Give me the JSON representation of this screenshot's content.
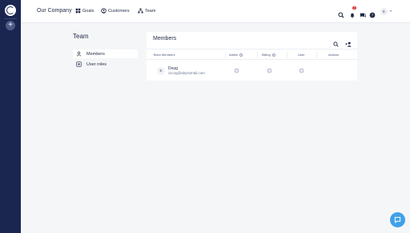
{
  "rail": {
    "logo": "app-logo-icon",
    "add_label": "+"
  },
  "topbar": {
    "company": "Our Company",
    "nav": [
      {
        "label": "Goals",
        "icon": "goals-icon"
      },
      {
        "label": "Customers",
        "icon": "customers-icon"
      },
      {
        "label": "Team",
        "icon": "team-icon"
      }
    ],
    "notifications_count": "1",
    "avatar_initial": "E"
  },
  "sidebar": {
    "title": "Team",
    "items": [
      {
        "label": "Members",
        "icon": "user-icon",
        "active": true
      },
      {
        "label": "User roles",
        "icon": "roles-icon",
        "active": false
      }
    ]
  },
  "members_panel": {
    "title": "Members",
    "columns": [
      "Team Members",
      "Admin",
      "Billing",
      "User",
      "Actions"
    ],
    "rows": [
      {
        "initial": "E",
        "name": "Doug",
        "email": "zxcvg@abyssmail.com",
        "admin": false,
        "billing": false,
        "user": false
      }
    ]
  },
  "colors": {
    "rail": "#1a2550",
    "accent": "#3fa1e8",
    "badge": "#e03a3a"
  }
}
